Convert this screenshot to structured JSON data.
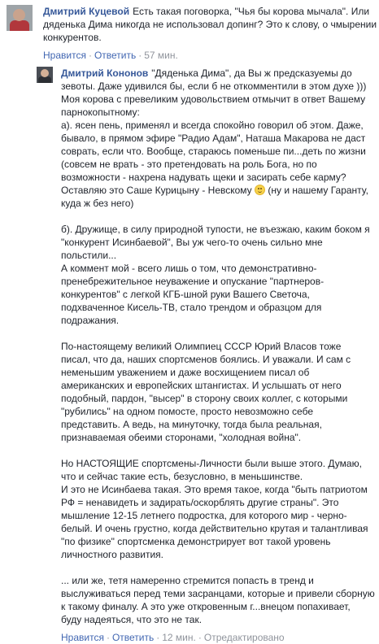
{
  "comment1": {
    "author": "Дмитрий Куцевой",
    "lines": [
      "Есть такая поговорка, \"Чья бы корова мычала\". Или",
      "дяденька Дима никогда не использовал допинг? Это к слову, о чмырении",
      "конкурентов."
    ],
    "actions": {
      "like": "Нравится",
      "reply": "Ответить",
      "time": "57 мин."
    }
  },
  "comment2": {
    "author": "Дмитрий Кононов",
    "p1": [
      "\"Дяденька Дима\", да Вы ж предсказуемы до",
      "зевоты. Даже удивился бы, если б не откомментили в этом духе )))",
      "Моя корова с превеликим удовольствием отмычит в ответ Вашему",
      "парнокопытному:",
      "а). ясен пень, применял и всегда спокойно говорил об этом. Даже,",
      "бывало, в прямом эфире \"Радио Адам\", Наташа Макарова не даст",
      "соврать, если что. Вообще, стараюсь поменьше пи...деть по жизни",
      "(совсем не врать - это претендовать на роль Бога, но по",
      "возможности - нахрена надувать щеки и засирать себе карму?",
      "Оставляю это Саше Курицыну - Невскому",
      "(ну и нашему Гаранту,",
      "куда ж без него)"
    ],
    "p2": [
      "б). Дружище, в силу природной тупости, не въезжаю, каким боком я",
      "\"конкурент Исинбаевой\", Вы уж чего-то очень сильно мне",
      "польстили...",
      "А коммент мой - всего лишь о том, что демонстративно-",
      "пренебрежительное неуважение и опускание \"партнеров-",
      "конкурентов\" с легкой КГБ-шной руки Вашего Светоча,",
      "подхваченное Кисель-ТВ, стало трендом и образцом для",
      "подражания."
    ],
    "p3": [
      "По-настоящему великий Олимпиец СССР Юрий Власов тоже",
      "писал, что да, наших спортсменов боялись. И уважали. И сам с",
      "неменьшим уважением и даже восхищением писал об",
      "американских и европейских штангистах. И услышать от него",
      "подобный, пардон, \"высер\" в сторону своих коллег, с которыми",
      "\"рубились\" на одном помосте, просто невозможно себе",
      "представить. А ведь, на минуточку, тогда была реальная,",
      "признаваемая обеими сторонами, \"холодная война\"."
    ],
    "p4": [
      "Но НАСТОЯЩИЕ спортсмены-Личности были выше этого. Думаю,",
      "что и сейчас такие есть, безусловно, в меньшинстве.",
      "И это не Исинбаева такая. Это время такое, когда \"быть патриотом",
      "РФ = ненавидеть и задирать/оскорблять другие страны\". Это",
      "мышление 12-15 летнего подростка, для которого мир - черно-",
      "белый. И очень грустно, когда действительно крутая и талантливая",
      "\"по физике\" спортсменка демонстрирует вот такой уровень",
      "личностного развития."
    ],
    "p5": [
      "... или же, тетя намеренно стремится попасть в тренд и",
      "выслуживаться перед теми засранцами, которые и привели сборную",
      "к такому финалу. А это уже откровенным г...внецом попахивает,",
      "буду надеяться, что это не так."
    ],
    "actions": {
      "like": "Нравится",
      "reply": "Ответить",
      "time": "12 мин.",
      "edited": "Отредактировано"
    }
  },
  "colors": {
    "link": "#365899",
    "action": "#4267b2",
    "muted": "#90949c",
    "text": "#1d2129"
  },
  "icons": {
    "emoji": "smile-emoji-icon"
  }
}
